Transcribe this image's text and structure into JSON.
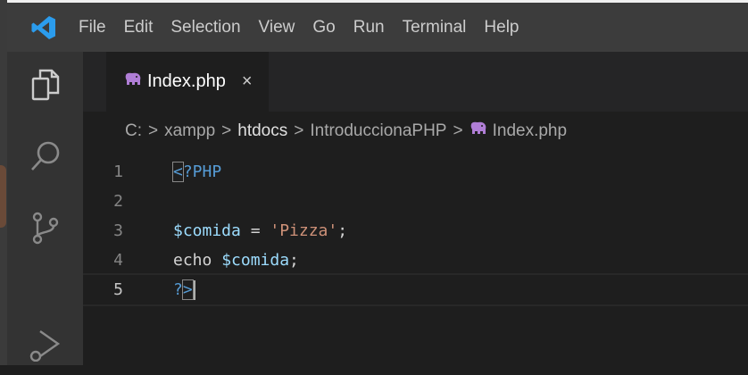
{
  "menu": [
    "File",
    "Edit",
    "Selection",
    "View",
    "Go",
    "Run",
    "Terminal",
    "Help"
  ],
  "tab": {
    "label": "Index.php",
    "close": "×"
  },
  "breadcrumb": {
    "items": [
      "C:",
      "xampp",
      "htdocs",
      "IntroduccionaPHP",
      "Index.php"
    ],
    "separator": ">"
  },
  "editor": {
    "lines": [
      {
        "number": "1",
        "open_bracket": "<",
        "rest": "?PHP"
      },
      {
        "number": "2"
      },
      {
        "number": "3",
        "var": "$comida",
        "op": " = ",
        "str": "'Pizza'",
        "end": ";"
      },
      {
        "number": "4",
        "kw": "echo ",
        "var": "$comida",
        "end": ";"
      },
      {
        "number": "5",
        "q": "?",
        "close_bracket": ">"
      }
    ]
  },
  "icons": [
    "vscode-logo-icon",
    "explorer-icon",
    "search-icon",
    "source-control-icon",
    "run-debug-icon",
    "php-elephant-icon",
    "close-icon"
  ],
  "colors": {
    "accent": "#007acc",
    "string": "#ce9178",
    "variable": "#9cdcfe",
    "tag": "#569cd6",
    "php_icon": "#b07ed6"
  }
}
